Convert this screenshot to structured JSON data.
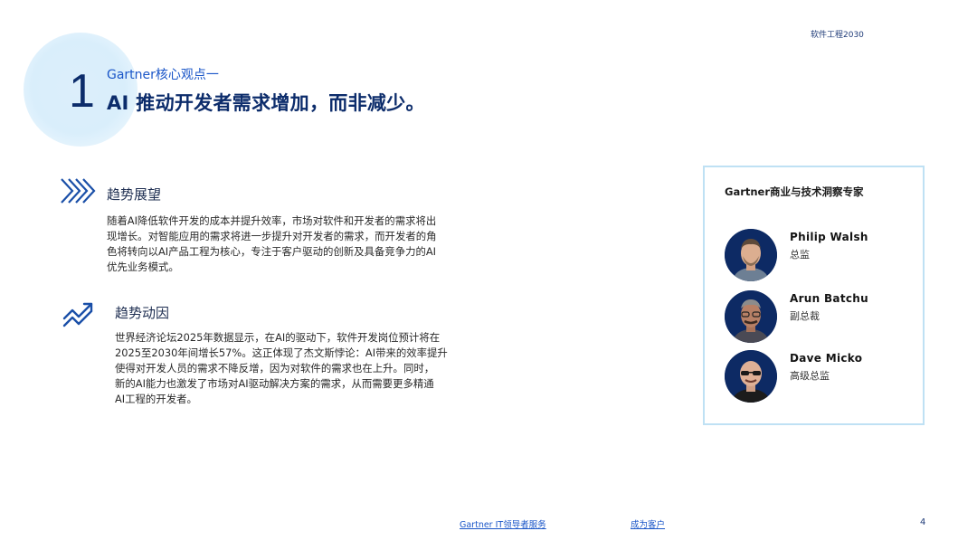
{
  "header": {
    "label": "软件工程2030"
  },
  "hero": {
    "number": "1",
    "subtitle": "Gartner核心观点一",
    "title": "AI 推动开发者需求增加，而非减少。"
  },
  "sections": [
    {
      "icon": "double-chevron-right-icon",
      "heading": "趋势展望",
      "lines": [
        "随着AI降低软件开发的成本并提升效率，市场对软件和开发者的需求将出",
        "现增长。对智能应用的需求将进一步提升对开发者的需求，而开发者的角",
        "色将转向以AI产品工程为核心，专注于客户驱动的创新及具备竞争力的AI",
        "优先业务模式。"
      ]
    },
    {
      "icon": "trend-up-icon",
      "heading": "趋势动因",
      "lines": [
        "世界经济论坛2025年数据显示，在AI的驱动下，软件开发岗位预计将在",
        "2025至2030年间增长57%。这正体现了杰文斯悖论：AI带来的效率提升",
        "使得对开发人员的需求不降反增，因为对软件的需求也在上升。同时，",
        "新的AI能力也激发了市场对AI驱动解决方案的需求，从而需要更多精通",
        "AI工程的开发者。"
      ]
    }
  ],
  "experts": {
    "title": "Gartner商业与技术洞察专家",
    "people": [
      {
        "name": "Philip  Walsh",
        "role": "总监"
      },
      {
        "name": "Arun  Batchu",
        "role": "副总裁"
      },
      {
        "name": "Dave  Micko",
        "role": "高级总监"
      }
    ]
  },
  "footer": {
    "link1": "Gartner  IT领导者服务",
    "link2": "成为客户",
    "page": "4"
  },
  "colors": {
    "navy": "#0c2c6b",
    "accent_blue": "#1a56c8",
    "box_border": "#bfe1f4"
  }
}
